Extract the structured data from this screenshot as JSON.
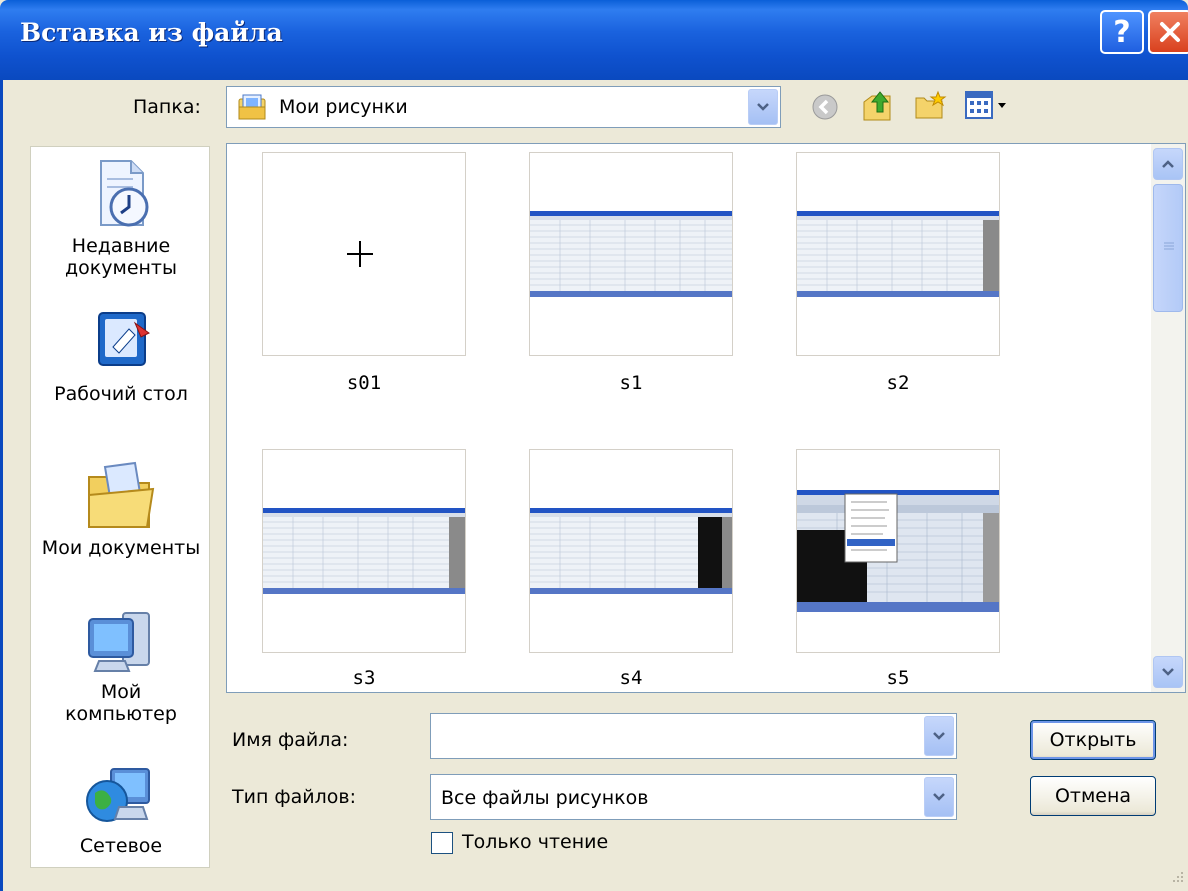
{
  "window": {
    "title": "Вставка из файла",
    "help_symbol": "?"
  },
  "folder": {
    "label": "Папка:",
    "value": "Мои рисунки"
  },
  "places": [
    {
      "id": "recent",
      "label_line1": "Недавние",
      "label_line2": "документы"
    },
    {
      "id": "desktop",
      "label_line1": "Рабочий стол",
      "label_line2": ""
    },
    {
      "id": "mydocs",
      "label_line1": "Мои документы",
      "label_line2": ""
    },
    {
      "id": "mycomp",
      "label_line1": "Мой",
      "label_line2": "компьютер"
    },
    {
      "id": "network",
      "label_line1": "Сетевое",
      "label_line2": ""
    }
  ],
  "files": [
    {
      "name": "s01"
    },
    {
      "name": "s1"
    },
    {
      "name": "s2"
    },
    {
      "name": "s3"
    },
    {
      "name": "s4"
    },
    {
      "name": "s5"
    }
  ],
  "filename": {
    "label": "Имя файла:",
    "value": ""
  },
  "filetype": {
    "label": "Тип файлов:",
    "value": "Все файлы рисунков"
  },
  "readonly": {
    "label": "Только чтение",
    "checked": false
  },
  "buttons": {
    "open": "Открыть",
    "cancel": "Отмена"
  },
  "colors": {
    "title_blue": "#0a5fd8",
    "dialog_bg": "#ece9d8",
    "close_red": "#d9411e"
  }
}
